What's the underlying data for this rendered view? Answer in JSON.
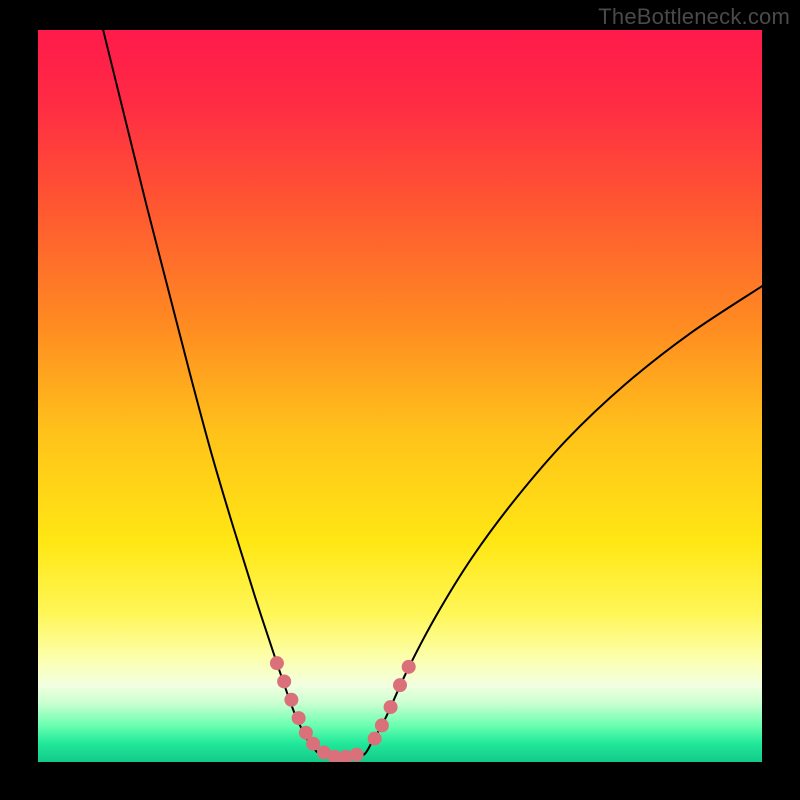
{
  "watermark": "TheBottleneck.com",
  "chart_data": {
    "type": "line",
    "title": "",
    "xlabel": "",
    "ylabel": "",
    "xlim": [
      0,
      100
    ],
    "ylim": [
      0,
      100
    ],
    "gradient_bands": [
      {
        "stop": 0.0,
        "color": "#ff1a4b"
      },
      {
        "stop": 0.1,
        "color": "#ff2b44"
      },
      {
        "stop": 0.25,
        "color": "#ff5a30"
      },
      {
        "stop": 0.4,
        "color": "#ff8a22"
      },
      {
        "stop": 0.55,
        "color": "#ffc21a"
      },
      {
        "stop": 0.7,
        "color": "#ffe714"
      },
      {
        "stop": 0.8,
        "color": "#fff75a"
      },
      {
        "stop": 0.86,
        "color": "#fcffb0"
      },
      {
        "stop": 0.895,
        "color": "#f2ffe0"
      },
      {
        "stop": 0.92,
        "color": "#c9ffd0"
      },
      {
        "stop": 0.95,
        "color": "#6affb0"
      },
      {
        "stop": 0.975,
        "color": "#20e89a"
      },
      {
        "stop": 1.0,
        "color": "#14c98a"
      }
    ],
    "series": [
      {
        "name": "left-curve",
        "type": "line",
        "color": "#000000",
        "width": 2,
        "x": [
          9,
          12,
          15,
          18,
          21,
          24,
          27,
          30,
          33,
          35.5,
          37.5
        ],
        "y": [
          100,
          88,
          76,
          64.5,
          53,
          42,
          32,
          22.5,
          13.5,
          6.5,
          2.5
        ]
      },
      {
        "name": "right-curve",
        "type": "line",
        "color": "#000000",
        "width": 2,
        "x": [
          46,
          48,
          51,
          55,
          60,
          66,
          73,
          81,
          90,
          100
        ],
        "y": [
          2.5,
          6,
          12.5,
          20,
          28,
          36,
          44,
          51.5,
          58.5,
          65
        ]
      },
      {
        "name": "valley-floor",
        "type": "line",
        "color": "#000000",
        "width": 2,
        "x": [
          37.5,
          39,
          41,
          43,
          45,
          46
        ],
        "y": [
          2.5,
          1.0,
          0.5,
          0.5,
          1.0,
          2.5
        ]
      },
      {
        "name": "left-highlight-dots",
        "type": "scatter",
        "color": "#d9707a",
        "radius_px": 7,
        "x": [
          33.0,
          34.0,
          35.0,
          36.0,
          37.0,
          38.0,
          39.5,
          41.0,
          42.5,
          44.0
        ],
        "y": [
          13.5,
          11.0,
          8.5,
          6.0,
          4.0,
          2.5,
          1.3,
          0.7,
          0.7,
          1.0
        ]
      },
      {
        "name": "right-highlight-dots",
        "type": "scatter",
        "color": "#d9707a",
        "radius_px": 7,
        "x": [
          46.5,
          47.5,
          48.7,
          50.0,
          51.2
        ],
        "y": [
          3.2,
          5.0,
          7.5,
          10.5,
          13.0
        ]
      }
    ]
  }
}
